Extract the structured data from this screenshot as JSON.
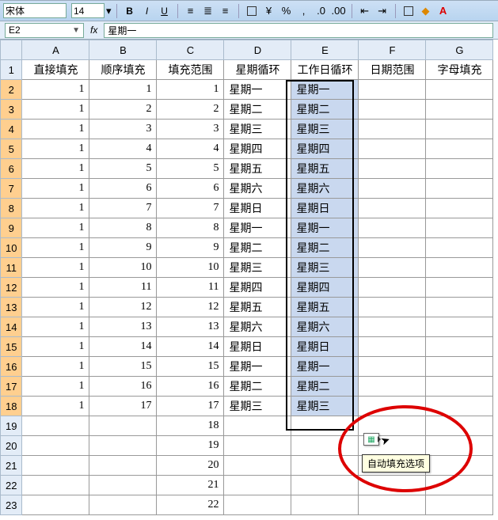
{
  "toolbar": {
    "font": "宋体",
    "font_size": "14",
    "bold": "B",
    "italic": "I",
    "underline": "U"
  },
  "namebox": {
    "cell_ref": "E2",
    "formula_label": "fx",
    "formula_value": "星期一"
  },
  "columns": [
    "A",
    "B",
    "C",
    "D",
    "E",
    "F",
    "G"
  ],
  "headerrow": [
    "直接填充",
    "顺序填充",
    "填充范围",
    "星期循环",
    "工作日循环",
    "日期范围",
    "字母填充"
  ],
  "rows": [
    {
      "r": 1,
      "cells": [
        "直接填充",
        "顺序填充",
        "填充范围",
        "星期循环",
        "工作日循环",
        "日期范围",
        "字母填充"
      ]
    },
    {
      "r": 2,
      "cells": [
        "1",
        "1",
        "1",
        "星期一",
        "星期一",
        "",
        ""
      ]
    },
    {
      "r": 3,
      "cells": [
        "1",
        "2",
        "2",
        "星期二",
        "星期二",
        "",
        ""
      ]
    },
    {
      "r": 4,
      "cells": [
        "1",
        "3",
        "3",
        "星期三",
        "星期三",
        "",
        ""
      ]
    },
    {
      "r": 5,
      "cells": [
        "1",
        "4",
        "4",
        "星期四",
        "星期四",
        "",
        ""
      ]
    },
    {
      "r": 6,
      "cells": [
        "1",
        "5",
        "5",
        "星期五",
        "星期五",
        "",
        ""
      ]
    },
    {
      "r": 7,
      "cells": [
        "1",
        "6",
        "6",
        "星期六",
        "星期六",
        "",
        ""
      ]
    },
    {
      "r": 8,
      "cells": [
        "1",
        "7",
        "7",
        "星期日",
        "星期日",
        "",
        ""
      ]
    },
    {
      "r": 9,
      "cells": [
        "1",
        "8",
        "8",
        "星期一",
        "星期一",
        "",
        ""
      ]
    },
    {
      "r": 10,
      "cells": [
        "1",
        "9",
        "9",
        "星期二",
        "星期二",
        "",
        ""
      ]
    },
    {
      "r": 11,
      "cells": [
        "1",
        "10",
        "10",
        "星期三",
        "星期三",
        "",
        ""
      ]
    },
    {
      "r": 12,
      "cells": [
        "1",
        "11",
        "11",
        "星期四",
        "星期四",
        "",
        ""
      ]
    },
    {
      "r": 13,
      "cells": [
        "1",
        "12",
        "12",
        "星期五",
        "星期五",
        "",
        ""
      ]
    },
    {
      "r": 14,
      "cells": [
        "1",
        "13",
        "13",
        "星期六",
        "星期六",
        "",
        ""
      ]
    },
    {
      "r": 15,
      "cells": [
        "1",
        "14",
        "14",
        "星期日",
        "星期日",
        "",
        ""
      ]
    },
    {
      "r": 16,
      "cells": [
        "1",
        "15",
        "15",
        "星期一",
        "星期一",
        "",
        ""
      ]
    },
    {
      "r": 17,
      "cells": [
        "1",
        "16",
        "16",
        "星期二",
        "星期二",
        "",
        ""
      ]
    },
    {
      "r": 18,
      "cells": [
        "1",
        "17",
        "17",
        "星期三",
        "星期三",
        "",
        ""
      ]
    },
    {
      "r": 19,
      "cells": [
        "",
        "",
        "18",
        "",
        "",
        "",
        ""
      ]
    },
    {
      "r": 20,
      "cells": [
        "",
        "",
        "19",
        "",
        "",
        "",
        ""
      ]
    },
    {
      "r": 21,
      "cells": [
        "",
        "",
        "20",
        "",
        "",
        "",
        ""
      ]
    },
    {
      "r": 22,
      "cells": [
        "",
        "",
        "21",
        "",
        "",
        "",
        ""
      ]
    },
    {
      "r": 23,
      "cells": [
        "",
        "",
        "22",
        "",
        "",
        "",
        ""
      ]
    }
  ],
  "tooltip": "自动填充选项",
  "selected_range": {
    "col": "E",
    "from": 2,
    "to": 18
  },
  "highlighted_rows_from": 2,
  "highlighted_rows_to": 18
}
